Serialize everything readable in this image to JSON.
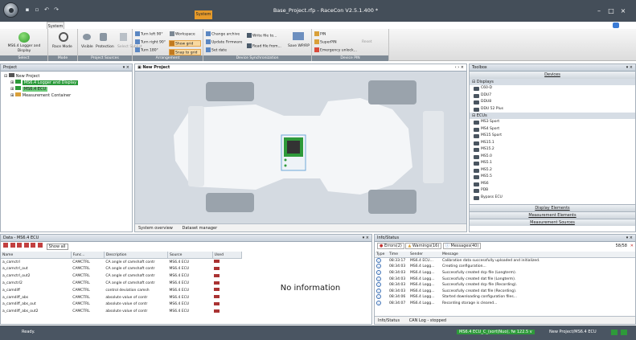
{
  "app": {
    "title": "Base_Project.rfp - RaceCon V2.5.1.400 *",
    "context_tab": "System"
  },
  "ribbon": {
    "tabs": [
      "System",
      "Logger",
      "Display",
      "Calibration/Measuring",
      "Tools",
      "Windows"
    ],
    "groups": [
      "Select",
      "Mode",
      "Project Sources",
      "Arrangement",
      "Device Synchronization",
      "Device PIN"
    ],
    "select_label": "MS6.4 Logger and Display",
    "mode": [
      "Race Mode"
    ],
    "sources": [
      "Visible",
      "Protection",
      "Select Sublist"
    ],
    "arrange": [
      "Turn left 90°",
      "Turn right 90°",
      "Turn 180°",
      "Workspace",
      "Show grid",
      "Snap to grid"
    ],
    "sync": [
      "Change archive",
      "Update Firmware",
      "Set date",
      "Write file to...",
      "Read file from...",
      "Save WP/RP"
    ],
    "pin": [
      "PIN",
      "SuperPIN",
      "Emergency unlock...",
      "Reset"
    ]
  },
  "project": {
    "title": "Project",
    "root": "New Project",
    "nodes": [
      "MS6.4 Logger and Display",
      "MS6.4 ECU",
      "Measurement Container"
    ]
  },
  "workspace": {
    "tab": "New Project",
    "bottom_tabs": [
      "System overview",
      "Dataset manager"
    ]
  },
  "toolbox": {
    "title": "Toolbox",
    "devices_header": "Devices",
    "displays_cat": "Displays",
    "displays": [
      "C60-D",
      "DDU7",
      "DDU8",
      "DDU 52 Plus"
    ],
    "ecus_cat": "ECUs",
    "ecus": [
      "MS3 Sport",
      "MS4 Sport",
      "MS15 Sport",
      "MS15.1",
      "MS15.2",
      "MS5.0",
      "MS5.1",
      "MS5.2",
      "MS5.5",
      "MS6",
      "PDB",
      "Bypass ECU"
    ],
    "bottom": [
      "Display Elements",
      "Measurement Elements",
      "Measurement Sources"
    ]
  },
  "data_pane": {
    "title": "Data - MS6.4 ECU",
    "show_all": "Show all",
    "columns": [
      "Name",
      "Func...",
      "Description",
      "Source",
      "Used"
    ],
    "rows": [
      [
        "a_camctrl",
        "CAMCTRL",
        "CA angle of camshaft contr",
        "MS6.4 ECU"
      ],
      [
        "a_camctrl_out",
        "CAMCTRL",
        "CA angle of camshaft contr",
        "MS6.4 ECU"
      ],
      [
        "a_camctrl_out2",
        "CAMCTRL",
        "CA angle of camshaft contr",
        "MS6.4 ECU"
      ],
      [
        "a_camctrl2",
        "CAMCTRL",
        "CA angle of camshaft contr",
        "MS6.4 ECU"
      ],
      [
        "a_camdiff",
        "CAMCTRL",
        "control deviation camsh",
        "MS6.4 ECU"
      ],
      [
        "a_camdiff_abs",
        "CAMCTRL",
        "absolute value of contr",
        "MS6.4 ECU"
      ],
      [
        "a_camdiff_abs_out",
        "CAMCTRL",
        "absolute value of contr",
        "MS6.4 ECU"
      ],
      [
        "a_camdiff_abs_out2",
        "CAMCTRL",
        "absolute value of contr",
        "MS6.4 ECU"
      ]
    ],
    "no_info": "No information"
  },
  "info_pane": {
    "title": "Info/Status",
    "filters": [
      "Errors(2)",
      "Warnings(16)",
      "Messages(40)"
    ],
    "count": "58/58",
    "columns": [
      "Type",
      "Time",
      "Sender",
      "Message"
    ],
    "rows": [
      [
        "08:33:17",
        "MS6.4 ECU...",
        "Calibration data successfully uploaded and initialized."
      ],
      [
        "08:34:03",
        "MS6.4 Logg...",
        "Creating configuration..."
      ],
      [
        "08:34:03",
        "MS6.4 Logg...",
        "Successfully created dcp file (Longterm)."
      ],
      [
        "08:34:03",
        "MS6.4 Logg...",
        "Successfully created dat file (Longterm)."
      ],
      [
        "08:34:03",
        "MS6.4 Logg...",
        "Successfully created dcp file (Recording)."
      ],
      [
        "08:34:03",
        "MS6.4 Logg...",
        "Successfully created dat file (Recording)."
      ],
      [
        "08:34:06",
        "MS6.4 Logg...",
        "Started downloading configuration files..."
      ],
      [
        "08:34:07",
        "MS6.4 Logg...",
        "Recording storage is cleared..."
      ]
    ],
    "bottom_tabs": [
      "Info/Status",
      "CAN Log - stopped"
    ]
  },
  "status": {
    "left": "Ready.",
    "ecu": "MS6.4 ECU_C_(sort)Nuo), fw 122.5 v",
    "project": "New Project/MS6.4 ECU"
  }
}
